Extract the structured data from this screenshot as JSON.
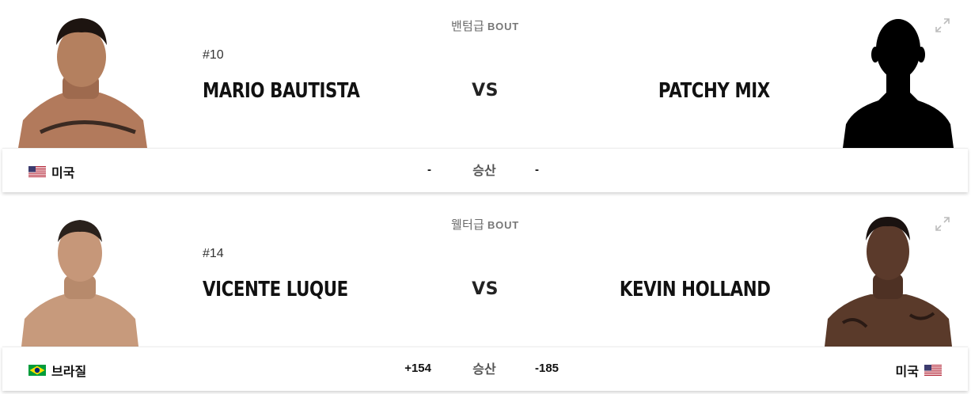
{
  "bouts": [
    {
      "weight_class": "밴텀급",
      "bout_word": "BOUT",
      "red": {
        "rank": "#10",
        "name": "MARIO BAUTISTA",
        "country": "미국",
        "flag": "us-flag-icon",
        "odds": "-"
      },
      "blue": {
        "rank": "",
        "name": "PATCHY MIX",
        "country": "",
        "flag": "",
        "odds": "-"
      },
      "vs": "VS",
      "odds_label": "승산"
    },
    {
      "weight_class": "웰터급",
      "bout_word": "BOUT",
      "red": {
        "rank": "#14",
        "name": "VICENTE LUQUE",
        "country": "브라질",
        "flag": "brazil-flag-icon",
        "odds": "+154"
      },
      "blue": {
        "rank": "",
        "name": "KEVIN HOLLAND",
        "country": "미국",
        "flag": "us-flag-icon",
        "odds": "-185"
      },
      "vs": "VS",
      "odds_label": "승산"
    }
  ],
  "colors": {
    "text": "#111111",
    "muted": "#6a6a6a",
    "background": "#ffffff"
  }
}
